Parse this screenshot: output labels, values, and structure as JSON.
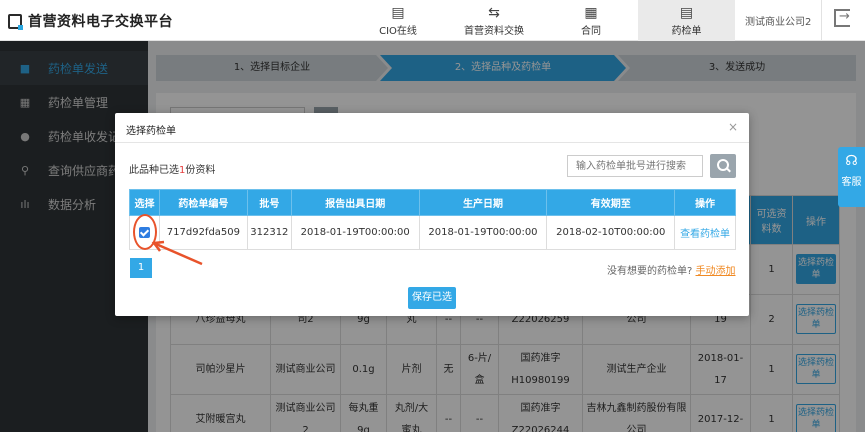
{
  "header": {
    "brand": "首营资料电子交换平台",
    "nav": [
      {
        "label": "CIO在线",
        "icon": "document-icon"
      },
      {
        "label": "首营资料交换",
        "icon": "exchange-icon"
      },
      {
        "label": "合同",
        "icon": "contract-icon"
      },
      {
        "label": "药检单",
        "icon": "report-icon",
        "active": true
      }
    ],
    "company": "测试商业公司2",
    "logout_icon": "logout-icon"
  },
  "sidebar": {
    "items": [
      {
        "label": "药检单发送",
        "icon": "doc-icon",
        "active": true
      },
      {
        "label": "药检单管理",
        "icon": "grid-icon"
      },
      {
        "label": "药检单收发记",
        "icon": "clock-icon"
      },
      {
        "label": "查询供应商药",
        "icon": "search-icon"
      },
      {
        "label": "数据分析",
        "icon": "bar-chart-icon"
      }
    ]
  },
  "steps": [
    {
      "label": "1、选择目标企业"
    },
    {
      "label": "2、选择品种及药检单",
      "active": true
    },
    {
      "label": "3、发送成功"
    }
  ],
  "bg_table": {
    "head_right": [
      "可选资料数",
      "操作"
    ],
    "rows": [
      {
        "c2": "",
        "c3": "",
        "c4": "",
        "c5": "",
        "c6": "",
        "c7": "",
        "c8": "",
        "c9": "",
        "c10": "",
        "count": "1",
        "op": "选择药检单"
      },
      {
        "c1": "八珍益母丸",
        "c2": "司2",
        "c3": "9g",
        "c4": "丸",
        "c5": "--",
        "c6": "--",
        "c7": "Z22026259",
        "c8": "公司",
        "c9": "19",
        "count": "2",
        "op": "选择药检单"
      },
      {
        "c1": "司帕沙星片",
        "c2": "测试商业公司",
        "c3": "0.1g",
        "c4": "片剂",
        "c5": "无",
        "c6": "6-片/盒",
        "c7": "国药准字H10980199",
        "c8": "测试生产企业",
        "c9": "2018-01-17",
        "count": "1",
        "op": "选择药检单"
      },
      {
        "c1": "艾附暖宫丸",
        "c2": "测试商业公司2",
        "c3": "每丸重9g",
        "c4": "丸剂/大蜜丸",
        "c5": "--",
        "c6": "--",
        "c7": "国药准字Z22026244",
        "c8": "吉林九鑫制药股份有限公司",
        "c9": "2017-12-",
        "count": "1",
        "op": "选择药检单"
      }
    ]
  },
  "customer_service": {
    "label": "客服",
    "icon": "headset-icon"
  },
  "modal": {
    "title": "选择药检单",
    "close": "×",
    "selected_prefix": "此品种已选",
    "selected_count": "1",
    "selected_suffix": "份资料",
    "search_placeholder": "输入药检单批号进行搜索",
    "columns": [
      "选择",
      "药检单编号",
      "批号",
      "报告出具日期",
      "生产日期",
      "有效期至",
      "操作"
    ],
    "rows": [
      {
        "checked": true,
        "code": "717d92fda509",
        "batch": "312312",
        "report_date": "2018-01-19T00:00:00",
        "prod_date": "2018-01-19T00:00:00",
        "expiry": "2018-02-10T00:00:00",
        "action": "查看药检单"
      }
    ],
    "page": "1",
    "no_want": "没有想要的药检单?",
    "manual_add": "手动添加",
    "save": "保存已选"
  },
  "colors": {
    "accent": "#33a8e6",
    "sidebar_bg": "#2f3437",
    "annotation": "#e8532b",
    "link_orange": "#f08a24"
  }
}
